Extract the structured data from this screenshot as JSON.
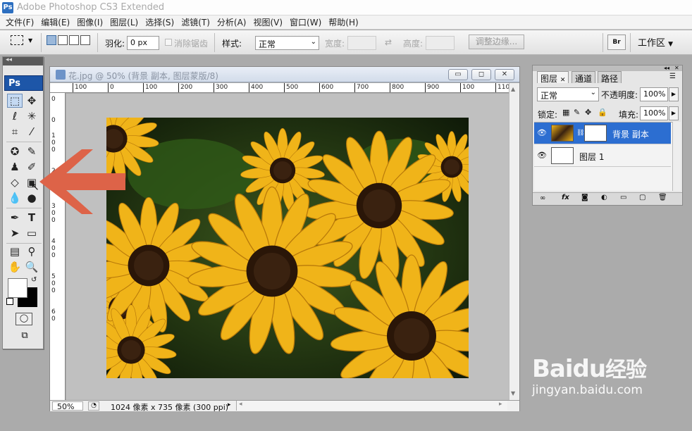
{
  "app": {
    "title": "Adobe Photoshop CS3 Extended",
    "logo": "Ps"
  },
  "menu": [
    "文件(F)",
    "编辑(E)",
    "图像(I)",
    "图层(L)",
    "选择(S)",
    "滤镜(T)",
    "分析(A)",
    "视图(V)",
    "窗口(W)",
    "帮助(H)"
  ],
  "options": {
    "feather_label": "羽化:",
    "feather_value": "0 px",
    "antialias_label": "消除锯齿",
    "style_label": "样式:",
    "style_value": "正常",
    "width_label": "宽度:",
    "height_label": "高度:",
    "refine_button": "调整边缘...",
    "bridge_label": "Br",
    "workspace_label": "工作区"
  },
  "toolbox": {
    "ps_label": "Ps"
  },
  "document": {
    "title": "花.jpg @ 50% (背景 副本, 图层蒙版/8)",
    "ruler_h": [
      "100",
      "0",
      "100",
      "200",
      "300",
      "400",
      "500",
      "600",
      "700",
      "800",
      "900",
      "100",
      "110"
    ],
    "ruler_v": [
      "0",
      "0",
      "1",
      "0",
      "0",
      "2",
      "0",
      "0",
      "3",
      "0",
      "0",
      "4",
      "0",
      "0",
      "5",
      "0",
      "0",
      "6",
      "0"
    ],
    "zoom": "50%",
    "info": "1024 像素 x 735 像素 (300 ppi)"
  },
  "layers_panel": {
    "tabs": [
      "图层",
      "通道",
      "路径"
    ],
    "blend_mode": "正常",
    "opacity_label": "不透明度:",
    "opacity_value": "100%",
    "lock_label": "锁定:",
    "fill_label": "填充:",
    "fill_value": "100%",
    "layers": [
      {
        "name": "背景 副本",
        "selected": true
      },
      {
        "name": "图层 1",
        "selected": false
      }
    ]
  },
  "watermark": {
    "brand": "Baidu",
    "brand_cn": "经验",
    "url": "jingyan.baidu.com"
  },
  "colors": {
    "arrow": "#dd6348",
    "selection": "#2c6ed1",
    "photo_petal": "#f0b419"
  }
}
